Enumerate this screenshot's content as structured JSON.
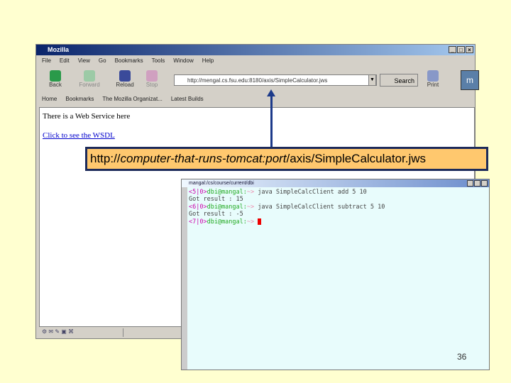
{
  "browser": {
    "title": "Mozilla",
    "menu": [
      "File",
      "Edit",
      "View",
      "Go",
      "Bookmarks",
      "Tools",
      "Window",
      "Help"
    ],
    "nav": {
      "back": "Back",
      "forward": "Forward",
      "reload": "Reload",
      "stop": "Stop",
      "search": "Search",
      "print": "Print"
    },
    "url": "http://mengal.cs.fsu.edu:8180/axis/SimpleCalculator.jws",
    "personal_bar": [
      "Home",
      "Bookmarks",
      "The Mozilla Organizat...",
      "Latest Builds"
    ],
    "content": {
      "text": "There is a Web Service here",
      "link": "Click to see the WSDL"
    }
  },
  "callout": {
    "prefix": "http://",
    "italic": "computer-that-runs-tomcat:port",
    "suffix": "/axis/SimpleCalculator.jws"
  },
  "terminal": {
    "title": "mangal:/cs/course/current/dbi",
    "lines": [
      {
        "prompt": "<5|0>",
        "user": "dbi@mangal:",
        "path": "~>",
        "cmd": " java SimpleCalcClient add 5 10"
      },
      {
        "out": "Got result : 15"
      },
      {
        "prompt": "<6|0>",
        "user": "dbi@mangal:",
        "path": "~>",
        "cmd": " java SimpleCalcClient subtract 5 10"
      },
      {
        "out": "Got result : -5"
      },
      {
        "prompt": "<7|0>",
        "user": "dbi@mangal:",
        "path": "~>",
        "cmd": " "
      }
    ]
  },
  "slide": {
    "page_number": "36"
  }
}
